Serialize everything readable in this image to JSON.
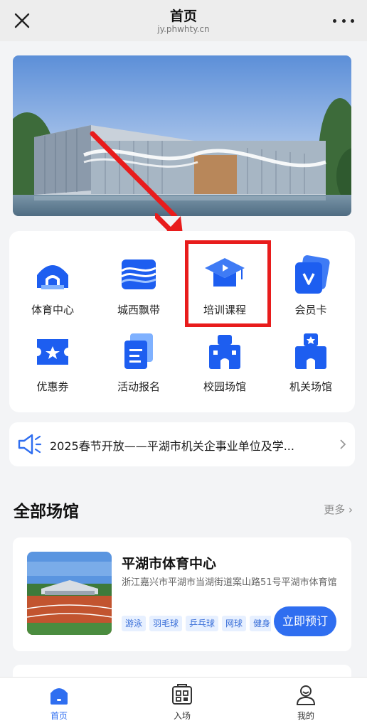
{
  "header": {
    "title": "首页",
    "url": "jy.phwhty.cn",
    "close_icon": "close-icon",
    "more_icon": "more-dots-icon"
  },
  "banner": {
    "image": "sports-center-building-photo"
  },
  "grid": {
    "items": [
      {
        "label": "体育中心",
        "icon": "stadium-icon"
      },
      {
        "label": "城西飘带",
        "icon": "ribbon-building-icon"
      },
      {
        "label": "培训课程",
        "icon": "graduation-cap-icon"
      },
      {
        "label": "会员卡",
        "icon": "member-card-icon"
      },
      {
        "label": "优惠券",
        "icon": "coupon-icon"
      },
      {
        "label": "活动报名",
        "icon": "activity-signup-icon"
      },
      {
        "label": "校园场馆",
        "icon": "campus-venue-icon"
      },
      {
        "label": "机关场馆",
        "icon": "government-venue-icon"
      }
    ]
  },
  "notice": {
    "text": "2025春节开放——平湖市机关企事业单位及学...",
    "icon": "speaker-icon"
  },
  "venues_section": {
    "title": "全部场馆",
    "more": "更多"
  },
  "venue": {
    "name": "平湖市体育中心",
    "address": "浙江嘉兴市平湖市当湖街道案山路51号平湖市体育馆",
    "tags": [
      "游泳",
      "羽毛球",
      "乒乓球",
      "网球",
      "健身"
    ],
    "book_label": "立即预订"
  },
  "tabbar": {
    "items": [
      {
        "label": "首页",
        "icon": "home-icon",
        "active": true
      },
      {
        "label": "入场",
        "icon": "entry-code-icon",
        "active": false
      },
      {
        "label": "我的",
        "icon": "profile-icon",
        "active": false
      }
    ]
  },
  "colors": {
    "accent": "#2f6ef0",
    "highlight_red": "#e81c1c",
    "icon_blue": "#1d5ef0"
  }
}
